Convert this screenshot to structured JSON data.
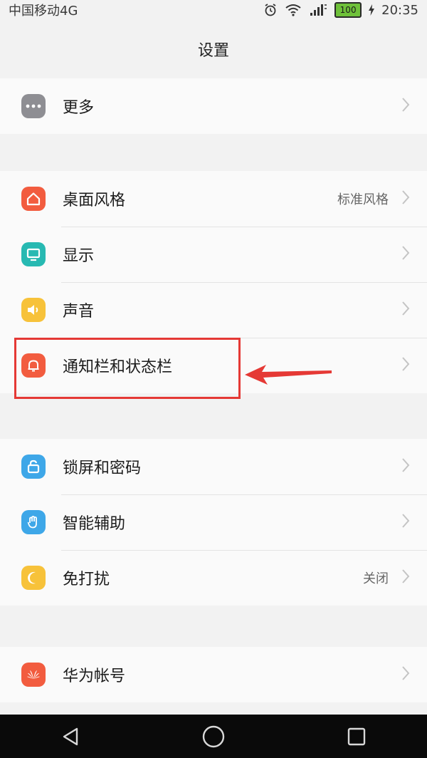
{
  "status_bar": {
    "carrier": "中国移动4G",
    "battery": "100",
    "time": "20:35"
  },
  "header": {
    "title": "设置"
  },
  "groups": [
    {
      "items": [
        {
          "label": "更多",
          "icon": "more-icon",
          "icon_color": "#8e8e93"
        }
      ]
    },
    {
      "items": [
        {
          "label": "桌面风格",
          "value": "标准风格",
          "icon": "home-icon",
          "icon_color": "#f25c3f"
        },
        {
          "label": "显示",
          "icon": "display-icon",
          "icon_color": "#27b9b2"
        },
        {
          "label": "声音",
          "icon": "speaker-icon",
          "icon_color": "#f7c23a"
        },
        {
          "label": "通知栏和状态栏",
          "icon": "bell-icon",
          "icon_color": "#f25c3f",
          "highlighted": true
        }
      ]
    },
    {
      "items": [
        {
          "label": "锁屏和密码",
          "icon": "lock-icon",
          "icon_color": "#3ea7e8"
        },
        {
          "label": "智能辅助",
          "icon": "hand-icon",
          "icon_color": "#3ea7e8"
        },
        {
          "label": "免打扰",
          "value": "关闭",
          "icon": "moon-icon",
          "icon_color": "#f7c23a"
        }
      ]
    },
    {
      "items": [
        {
          "label": "华为帐号",
          "icon": "huawei-icon",
          "icon_color": "#f25c3f"
        }
      ]
    }
  ],
  "colors": {
    "annotation": "#e53935",
    "nav_bar": "#0a0a0a"
  }
}
